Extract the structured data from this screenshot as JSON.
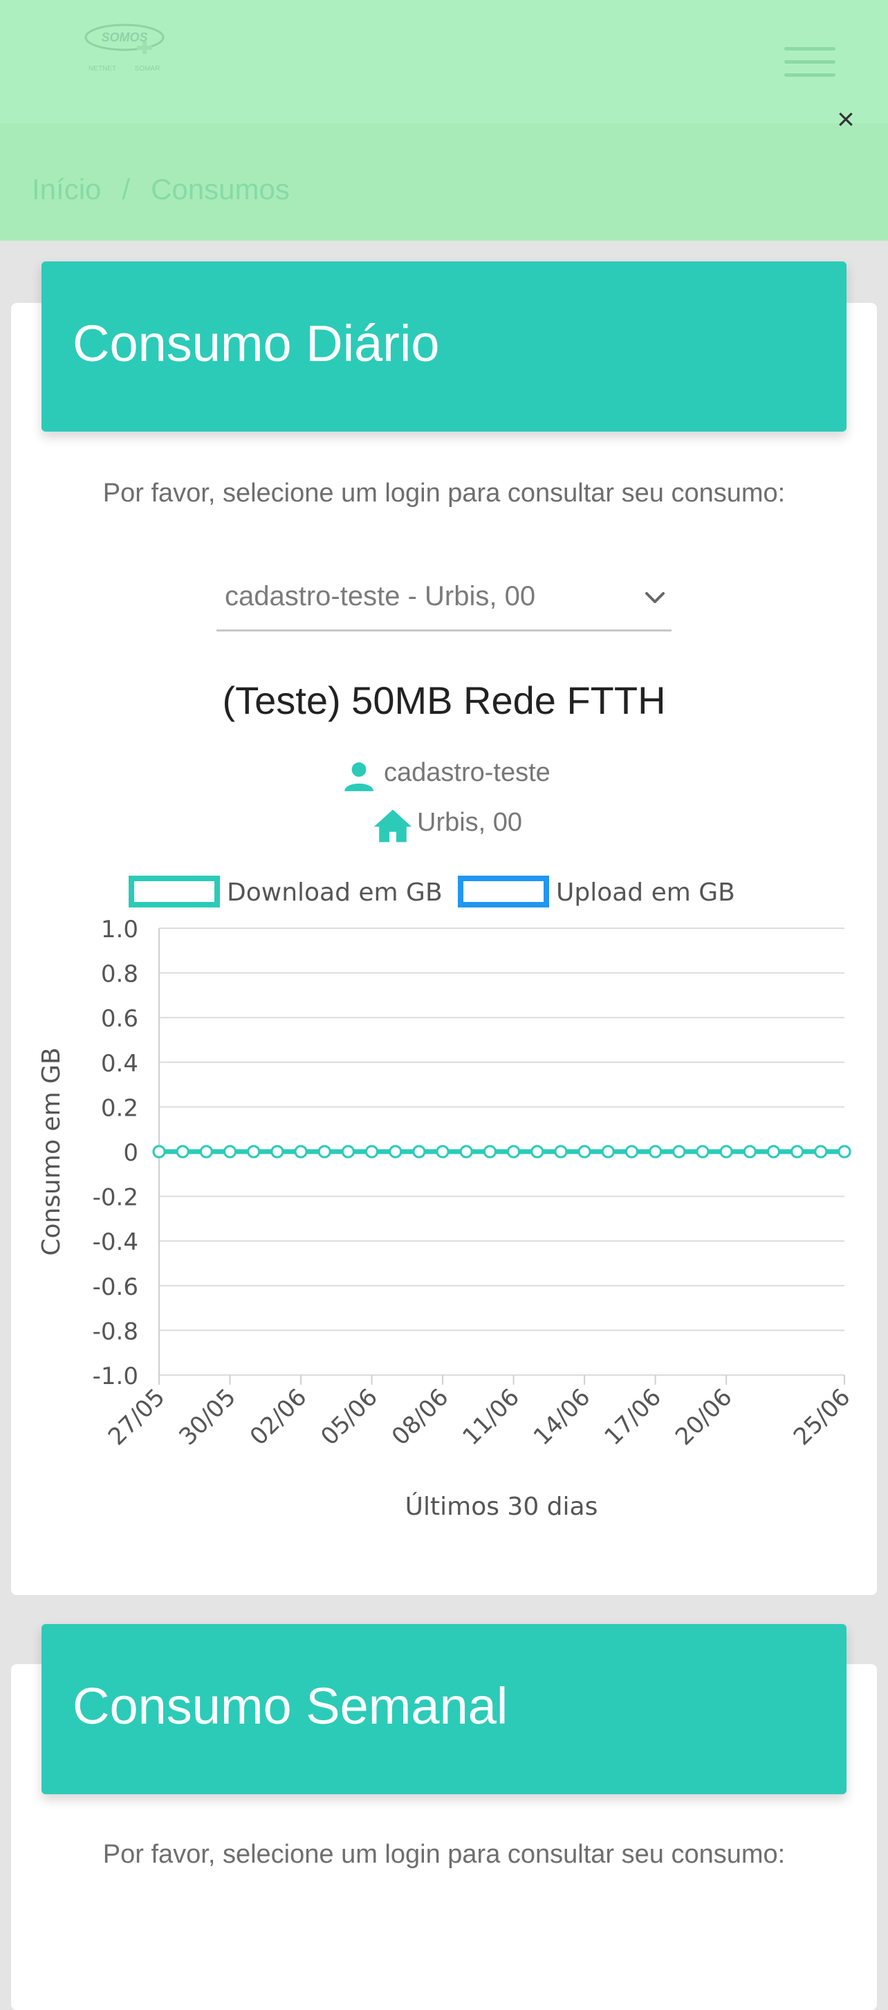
{
  "breadcrumb": {
    "home": "Início",
    "separator": "/",
    "current": "Consumos"
  },
  "close_symbol": "×",
  "sections": {
    "daily": {
      "title": "Consumo Diário",
      "hint": "Por favor, selecione um login para consultar seu consumo:"
    },
    "weekly": {
      "title": "Consumo Semanal",
      "hint": "Por favor, selecione um login para consultar seu consumo:"
    }
  },
  "login_select": {
    "selected": "cadastro-teste - Urbis, 00"
  },
  "plan_name": "(Teste) 50MB Rede FTTH",
  "user": {
    "login": "cadastro-teste",
    "address": "Urbis, 00"
  },
  "icons": {
    "user": "person-icon",
    "address": "home-icon",
    "menu": "hamburger-icon",
    "dropdown": "chevron-down-icon",
    "close": "close-icon"
  },
  "colors": {
    "accent": "#2bcbb8",
    "download": "#2bcbb8",
    "upload": "#2196f3",
    "header": "#aeefc0"
  },
  "chart_data": {
    "type": "line",
    "xlabel": "Últimos 30 dias",
    "ylabel": "Consumo em GB",
    "ylim": [
      -1.0,
      1.0
    ],
    "yticks": [
      "1.0",
      "0.8",
      "0.6",
      "0.4",
      "0.2",
      "0",
      "-0.2",
      "-0.4",
      "-0.6",
      "-0.8",
      "-1.0"
    ],
    "tick_labels": [
      "27/05",
      "30/05",
      "02/06",
      "05/06",
      "08/06",
      "11/06",
      "14/06",
      "17/06",
      "20/06",
      "25/06"
    ],
    "x": [
      "27/05",
      "28/05",
      "29/05",
      "30/05",
      "31/05",
      "01/06",
      "02/06",
      "03/06",
      "04/06",
      "05/06",
      "06/06",
      "07/06",
      "08/06",
      "09/06",
      "10/06",
      "11/06",
      "12/06",
      "13/06",
      "14/06",
      "15/06",
      "16/06",
      "17/06",
      "18/06",
      "19/06",
      "20/06",
      "21/06",
      "22/06",
      "23/06",
      "24/06",
      "25/06"
    ],
    "series": [
      {
        "name": "Download em GB",
        "color": "#2bcbb8",
        "values": [
          0,
          0,
          0,
          0,
          0,
          0,
          0,
          0,
          0,
          0,
          0,
          0,
          0,
          0,
          0,
          0,
          0,
          0,
          0,
          0,
          0,
          0,
          0,
          0,
          0,
          0,
          0,
          0,
          0,
          0
        ]
      },
      {
        "name": "Upload em GB",
        "color": "#2196f3",
        "values": [
          0,
          0,
          0,
          0,
          0,
          0,
          0,
          0,
          0,
          0,
          0,
          0,
          0,
          0,
          0,
          0,
          0,
          0,
          0,
          0,
          0,
          0,
          0,
          0,
          0,
          0,
          0,
          0,
          0,
          0
        ]
      }
    ],
    "legend": "top",
    "grid": true
  }
}
